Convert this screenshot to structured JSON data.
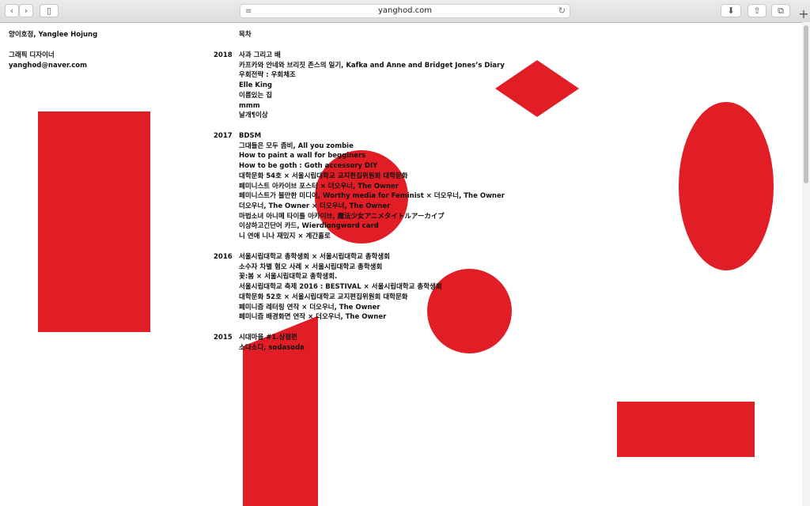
{
  "browser": {
    "url": "yanghod.com",
    "back_icon": "chevron-left-icon",
    "forward_icon": "chevron-right-icon",
    "sidebar_icon": "sidebar-icon",
    "download_icon": "download-icon",
    "share_icon": "share-icon",
    "tabs_icon": "tabs-icon",
    "new_tab_icon": "plus-icon"
  },
  "profile": {
    "name": "양이호정, Yanglee Hojung",
    "role": "그래픽 디자이너",
    "email": "yanghod@naver.com"
  },
  "toc": {
    "title": "목차",
    "years": [
      {
        "year": "2018",
        "items": [
          "사과 그리고 배",
          "카프카와 안네와 브리짓 존스의 일기, Kafka and Anne and Bridget Jones’s Diary",
          "우회전략 : 우회체조",
          "Elle King",
          "이름있는 집",
          "mmm",
          "날개¶이상"
        ]
      },
      {
        "year": "2017",
        "items": [
          "BDSM",
          "그대들은 모두 좀비, All you zombie",
          "How to paint a wall for begginers",
          "How to be goth : Goth accessory DIY",
          "대학문화 54호 × 서울시립대학교 교지편집위원회 대학문화",
          "페미니스트 아카이브 포스터 × 더오우너, The Owner",
          "페미니스트가 불만한 미디어, Worthy media for Feminist × 더오우너, The Owner",
          "더오우너, The Owner × 더오우너, The Owner",
          "마법소녀 아니메 타이틀 아카이브, 魔法少女アニメタイトルアーカイブ",
          "이상하고긴단어 카드, Wierdlongword card",
          "니 연애 니나 재밌지 × 계간홀로"
        ]
      },
      {
        "year": "2016",
        "items": [
          "서울시립대학교 총학생회 × 서울시립대학교 총학생회",
          "소수자 차별 혐오 사례 × 서울시립대학교 총학생회",
          "꽃:봄 × 서울시립대학교 총학생회.",
          "서울시립대학교 축제 2016 : BESTIVAL × 서울시립대학교 총학생회",
          "대학문화 52호 × 서울시립대학교 교지편집위원회 대학문화",
          "페미니즘 레터링 연작 × 더오우너, The Owner",
          "페미니즘 배경화면 연작 × 더오우너, The Owner"
        ]
      },
      {
        "year": "2015",
        "items": [
          "시대마을 #1.상점편",
          "소다소다, sodasoda"
        ]
      }
    ]
  },
  "colors": {
    "accent": "#e11d26"
  }
}
